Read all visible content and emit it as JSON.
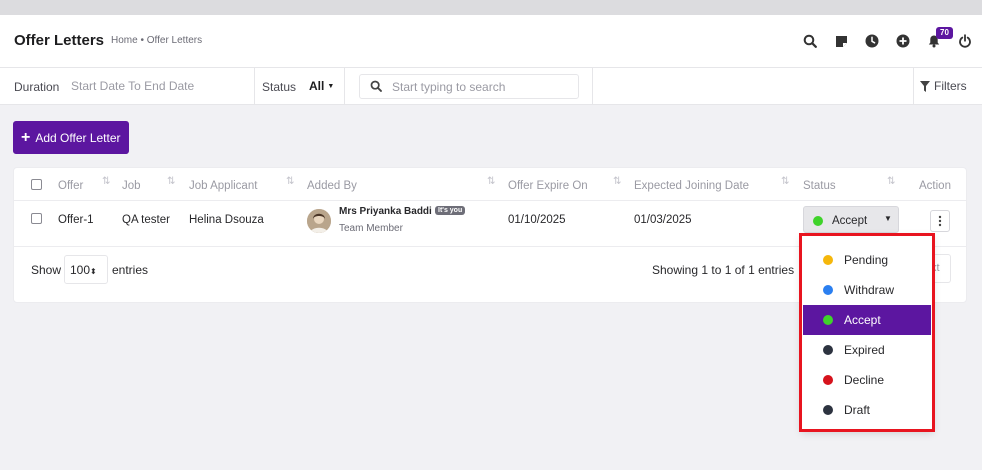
{
  "header": {
    "title": "Offer Letters",
    "breadcrumb": "Home • Offer Letters",
    "notification_count": "70"
  },
  "filters": {
    "duration_label": "Duration",
    "date_range": "Start Date To End Date",
    "status_label": "Status",
    "status_value": "All",
    "search_placeholder": "Start typing to search",
    "filters_label": "Filters"
  },
  "add_button_label": "Add Offer Letter",
  "table": {
    "columns": [
      "Offer",
      "Job",
      "Job Applicant",
      "Added By",
      "Offer Expire On",
      "Expected Joining Date",
      "Status",
      "Action"
    ],
    "rows": [
      {
        "offer": "Offer-1",
        "job": "QA tester",
        "applicant": "Helina Dsouza",
        "added_by_name": "Mrs Priyanka Baddi",
        "added_by_badge": "It's you",
        "added_by_role": "Team Member",
        "expire_on": "01/10/2025",
        "joining_date": "01/03/2025",
        "status": "Accept",
        "status_color": "#3fd32a"
      }
    ]
  },
  "footer": {
    "show_label": "Show",
    "entries_value": "100",
    "entries_label": "entries",
    "showing_text": "Showing 1 to 1 of 1 entries"
  },
  "status_dropdown": {
    "options": [
      {
        "label": "Pending",
        "color": "#f5b70b"
      },
      {
        "label": "Withdraw",
        "color": "#2b7ff0"
      },
      {
        "label": "Accept",
        "color": "#3fd32a",
        "selected": true
      },
      {
        "label": "Expired",
        "color": "#2d3340"
      },
      {
        "label": "Decline",
        "color": "#d6121c"
      },
      {
        "label": "Draft",
        "color": "#2d3340"
      }
    ]
  },
  "colors": {
    "accent": "#5c16a0",
    "highlight_border": "#e8141f"
  }
}
